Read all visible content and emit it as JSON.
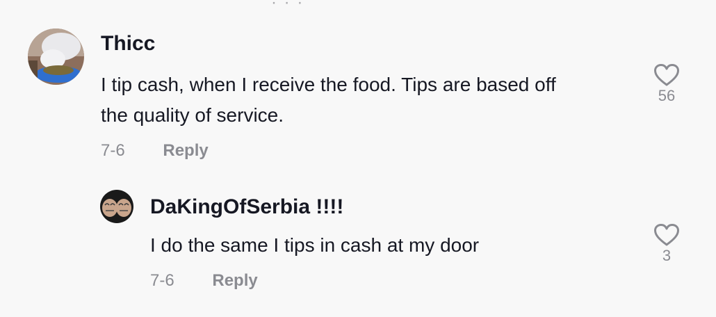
{
  "comments": [
    {
      "author": "Thicc",
      "text_lines": [
        "I tip cash, when I receive the food. Tips are based off",
        "the quality of service."
      ],
      "date": "7-6",
      "reply_label": "Reply",
      "likes": "56",
      "avatar_icon": "cat-eating-avatar"
    }
  ],
  "replies": [
    {
      "author": "DaKingOfSerbia !!!!",
      "text": "I do the same I tips in cash at my door",
      "date": "7-6",
      "reply_label": "Reply",
      "likes": "3",
      "avatar_icon": "tattooed-fists-avatar"
    }
  ],
  "colors": {
    "background": "#f8f8f8",
    "primary_text": "#161823",
    "secondary_text": "#8a8b91"
  },
  "icons": {
    "like": "heart-outline-icon"
  }
}
